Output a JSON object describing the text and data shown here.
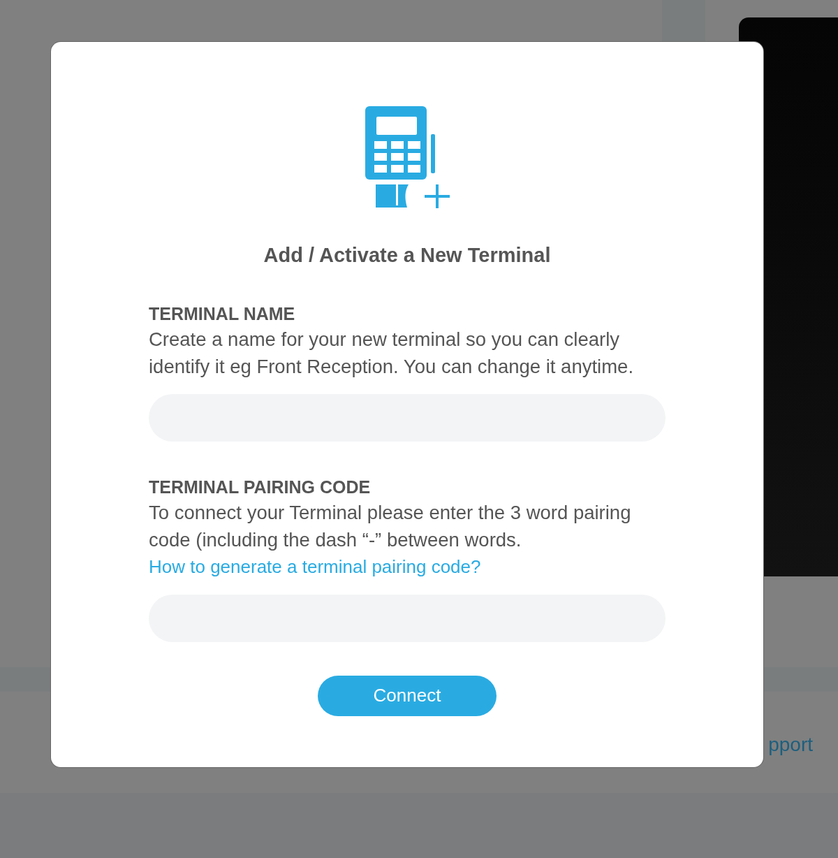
{
  "background": {
    "support_link": "pport"
  },
  "modal": {
    "title": "Add / Activate a New Terminal",
    "sections": [
      {
        "label": "TERMINAL NAME",
        "description": "Create a name for your new terminal so you can clearly identify it eg Front Reception. You can change it anytime."
      },
      {
        "label": "TERMINAL PAIRING CODE",
        "description": "To connect your Terminal please enter the 3 word pairing code (including the dash “-” between words.",
        "link": "How to generate a terminal pairing code?"
      }
    ],
    "button": "Connect"
  }
}
